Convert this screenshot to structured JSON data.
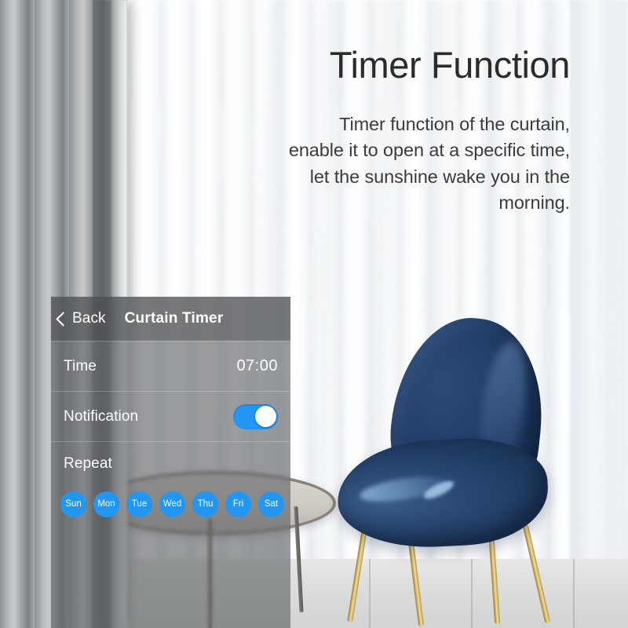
{
  "marketing": {
    "headline": "Timer Function",
    "subcopy": "Timer function of the curtain, enable it to open at a specific time, let the sunshine wake you in the morning."
  },
  "app_panel": {
    "header": {
      "back_label": "Back",
      "back_icon": "chevron-left-icon",
      "title": "Curtain Timer"
    },
    "rows": {
      "time": {
        "label": "Time",
        "value": "07:00"
      },
      "notification": {
        "label": "Notification",
        "toggle_state": "on"
      },
      "repeat": {
        "label": "Repeat"
      }
    },
    "days": [
      {
        "label": "Sun",
        "selected": true
      },
      {
        "label": "Mon",
        "selected": true
      },
      {
        "label": "Tue",
        "selected": true
      },
      {
        "label": "Wed",
        "selected": true
      },
      {
        "label": "Thu",
        "selected": true
      },
      {
        "label": "Fri",
        "selected": true
      },
      {
        "label": "Sat",
        "selected": true
      }
    ]
  },
  "colors": {
    "accent_blue": "#2196f3",
    "panel_overlay": "rgba(92,96,99,0.62)",
    "text_white": "#ffffff",
    "headline_text": "#2b2b2b",
    "chair_navy": "#23406a",
    "chair_legs_gold": "#d7b463"
  },
  "scene": {
    "left_curtain": "grey-drape",
    "right_curtain": "white-sheer-curtain",
    "furniture": [
      "navy-velvet-chair",
      "round-coffee-table"
    ]
  }
}
